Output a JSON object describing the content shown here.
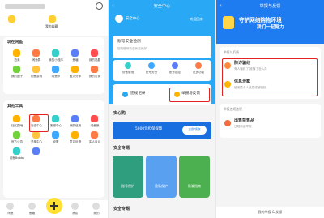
{
  "panel1": {
    "header": {
      "right_link": "我的收藏"
    },
    "section_fun": {
      "title": "玩在闲鱼",
      "items": [
        "拍卖",
        "闲鱼群",
        "我的小程序",
        "鱼塘",
        "我的话题",
        "我的圈子",
        "闲鱼游戏",
        "闲鱼币",
        "宝贝分享",
        "我的订阅",
        "会玩工具",
        "闲鱼小铺"
      ]
    },
    "section_tools": {
      "title": "其他工具",
      "items": [
        "社区园地",
        "安全中心",
        "客服中心",
        "我的信用",
        "闲鱼侠",
        "官方公告",
        "兑换中心",
        "设置",
        "意见反馈",
        "实人认证",
        "闲鱼Bobby",
        ""
      ]
    },
    "tabs": [
      "闲鱼",
      "鱼塘",
      "卖闲置",
      "消息",
      "我的"
    ],
    "accent": "#ffe033"
  },
  "panel2": {
    "title": "安全中心",
    "subtitle": "安全中心",
    "welcome": "欢迎回来",
    "account_check": {
      "title": "账号安全检测",
      "desc": "您的账号安全状态良好"
    },
    "icons": [
      "设备管理",
      "账号安全",
      "账号锁定",
      "更多功能"
    ],
    "actions": {
      "records": "违规记录",
      "report": "举报与反馈"
    },
    "safe_buy": {
      "title": "安心购",
      "promo": "5000元担保保障",
      "btn": "立即领取"
    },
    "topics": {
      "title": "安全专题",
      "cards": [
        "账号保护",
        "隐私保护",
        "防骗指南"
      ]
    },
    "footer_title": "安全专题",
    "header_color": "#29a8f5"
  },
  "panel3": {
    "title": "举报与反馈",
    "banner_line1": "守护网络购物环境",
    "banner_line2": "我们一起努力",
    "section_fraud": {
      "title": "举报与反馈",
      "rows": [
        {
          "title": "防诈骗线",
          "desc": "有人骗我了/被骗了怎么办"
        },
        {
          "title": "信息泄露",
          "desc": "被泄露个人信息或被骚扰"
        }
      ]
    },
    "section_other": {
      "title": "举报违规违规",
      "rows": [
        {
          "title": "出售禁售品",
          "desc": "违规商品举报"
        }
      ]
    },
    "bottom_link": "我的举报 & 反馈",
    "banner_color": "#1e7cf0"
  }
}
